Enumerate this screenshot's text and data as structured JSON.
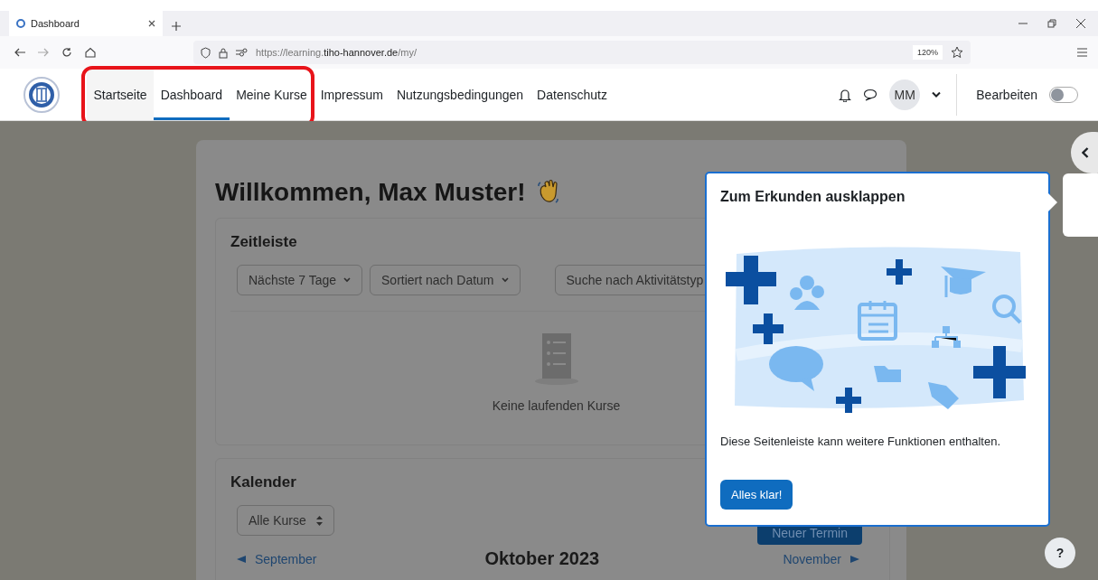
{
  "browser": {
    "tab_title": "Dashboard",
    "url_prefix": "https://learning.",
    "url_host": "tiho-hannover.de",
    "url_path": "/my/",
    "zoom": "120%"
  },
  "navbar": {
    "items": [
      {
        "label": "Startseite",
        "selected": false
      },
      {
        "label": "Dashboard",
        "selected": true
      },
      {
        "label": "Meine Kurse",
        "selected": false
      },
      {
        "label": "Impressum",
        "selected": false
      },
      {
        "label": "Nutzungsbedingungen",
        "selected": false
      },
      {
        "label": "Datenschutz",
        "selected": false
      }
    ],
    "avatar": "MM",
    "edit_label": "Bearbeiten",
    "edit_on": false
  },
  "page": {
    "heading": "Willkommen, Max Muster!",
    "timeline": {
      "title": "Zeitleiste",
      "filters": [
        "Nächste 7 Tage",
        "Sortiert nach Datum"
      ],
      "search_placeholder": "Suche nach Aktivitätstyp",
      "empty_message": "Keine laufenden Kurse"
    },
    "calendar": {
      "title": "Kalender",
      "course_filter": "Alle Kurse",
      "new_event": "Neuer Termin",
      "prev_month": "September",
      "month": "Oktober 2023",
      "next_month": "November"
    }
  },
  "popover": {
    "title": "Zum Erkunden ausklappen",
    "text": "Diese Seitenleiste kann weitere Funktionen enthalten.",
    "button": "Alles klar!"
  },
  "help": "?"
}
